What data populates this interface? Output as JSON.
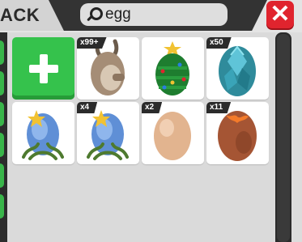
{
  "header": {
    "title": "ACK",
    "search": {
      "value": "egg"
    }
  },
  "items": [
    {
      "name": "add-item",
      "badge": ""
    },
    {
      "name": "kangaroo-egg",
      "badge": "x99+"
    },
    {
      "name": "christmas-tree-egg",
      "badge": ""
    },
    {
      "name": "crystal-egg",
      "badge": "x50"
    },
    {
      "name": "starry-egg-1",
      "badge": ""
    },
    {
      "name": "starry-egg-2",
      "badge": "x4"
    },
    {
      "name": "cracked-egg",
      "badge": "x2"
    },
    {
      "name": "lava-egg",
      "badge": "x11"
    }
  ],
  "colors": {
    "accent": "#35c24c",
    "close": "#e0242e",
    "dark": "#2b2b2b"
  },
  "icons": {
    "search": "search-icon",
    "close": "close-icon",
    "add": "plus-icon"
  }
}
